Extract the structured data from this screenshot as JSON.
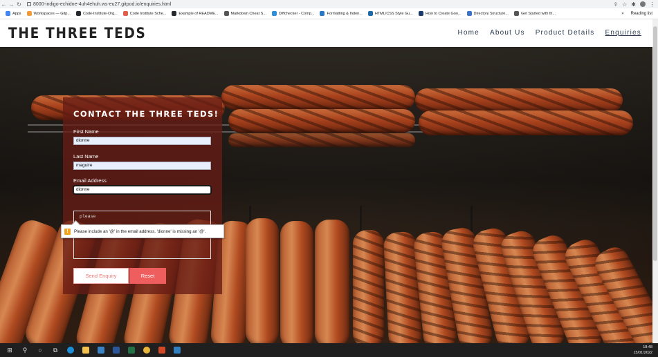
{
  "browser": {
    "url": "8000-indigo-echidne-4uh4ehuh.ws-eu27.gitpod.io/enquiries.html",
    "bookmarks": [
      {
        "label": "Apps",
        "color": "#4285f4"
      },
      {
        "label": "Workspaces — Gitp...",
        "color": "#f29b38"
      },
      {
        "label": "Code-Institute-Org...",
        "color": "#24292e"
      },
      {
        "label": "Code Institute Sche...",
        "color": "#e25d4a"
      },
      {
        "label": "Example of README...",
        "color": "#24292e"
      },
      {
        "label": "Markdown Cheat S...",
        "color": "#555555"
      },
      {
        "label": "Diffchecker - Comp...",
        "color": "#2f8fd8"
      },
      {
        "label": "Formatting & Inden...",
        "color": "#2a76c6"
      },
      {
        "label": "HTML/CSS Style Gu...",
        "color": "#1e6aa8"
      },
      {
        "label": "How to Create Goo...",
        "color": "#1a3a6b"
      },
      {
        "label": "Directory Structure...",
        "color": "#3b73c8"
      },
      {
        "label": "Get Started with th...",
        "color": "#555555"
      }
    ],
    "bookmarks_more": "»",
    "reading_list": "Reading list"
  },
  "site": {
    "brand": "THE THREE TEDS",
    "nav": [
      "Home",
      "About Us",
      "Product Details",
      "Enquiries"
    ],
    "active_nav": "Enquiries"
  },
  "form": {
    "title": "CONTACT THE THREE TEDS!",
    "first_name_label": "First Name",
    "first_name_value": "dionne",
    "last_name_label": "Last Name",
    "last_name_value": "maguire",
    "email_label": "Email Address",
    "email_value": "dionne",
    "message_value": "please",
    "send_label": "Send Enquiry",
    "reset_label": "Reset",
    "validation_message": "Please include an '@' in the email address. 'dionne' is missing an '@'."
  },
  "taskbar": {
    "time": "18:48",
    "date": "15/01/2022"
  },
  "colors": {
    "form_panel": "#661c14",
    "reset_button": "#ee5e5e",
    "nav_text": "#2c3d52"
  }
}
